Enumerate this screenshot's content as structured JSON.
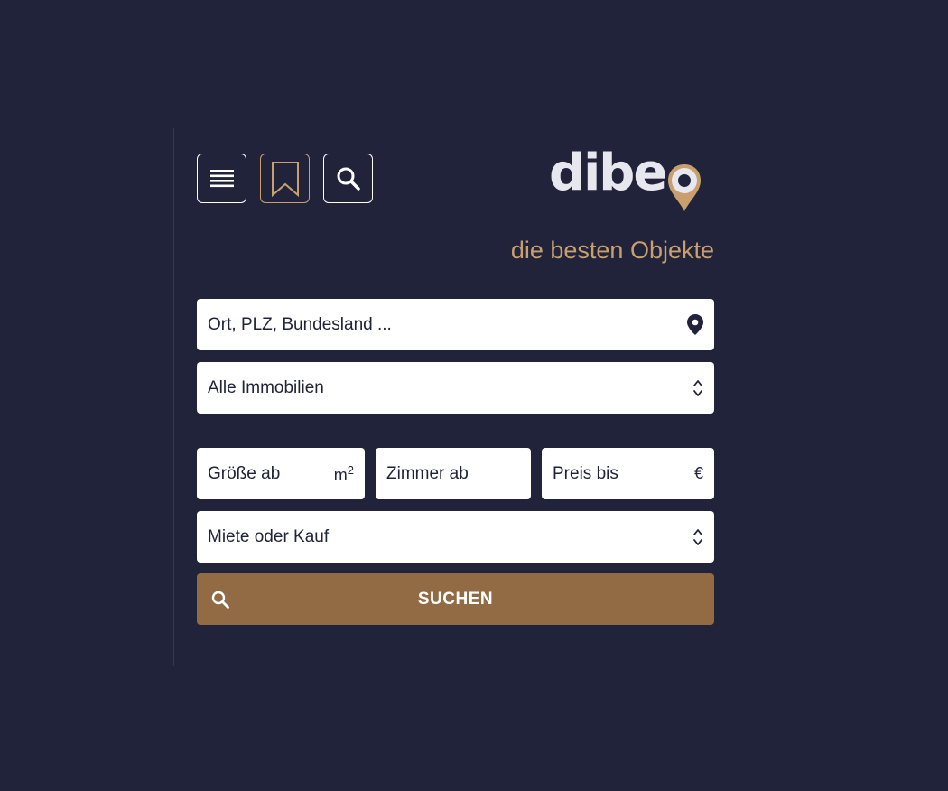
{
  "toolbar": {
    "menu_icon": "menu-icon",
    "bookmark_icon": "bookmark-icon",
    "search_icon": "search-icon"
  },
  "brand": {
    "logo_text": "dibe",
    "tagline": "die besten Objekte",
    "accent_color": "#c9a06d",
    "background_color": "#20233a",
    "button_color": "#926b45"
  },
  "search_form": {
    "location_placeholder": "Ort, PLZ, Bundesland ...",
    "property_type": "Alle Immobilien",
    "size_placeholder": "Größe ab",
    "size_unit": "m",
    "size_unit_exp": "2",
    "rooms_placeholder": "Zimmer ab",
    "price_placeholder": "Preis bis",
    "price_unit": "€",
    "rent_or_buy": "Miete oder Kauf",
    "submit_label": "SUCHEN"
  }
}
